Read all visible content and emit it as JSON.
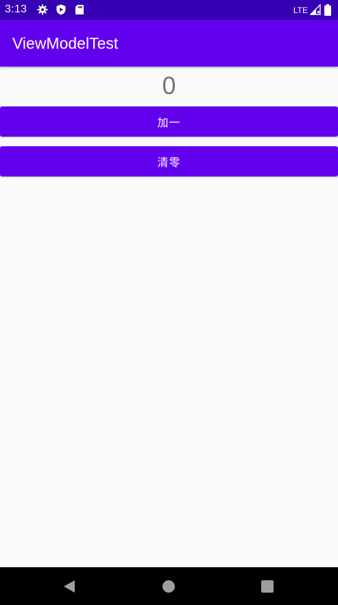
{
  "status_bar": {
    "time": "3:13",
    "network": "LTE",
    "icons": [
      "settings-icon",
      "play-protect-icon",
      "sd-card-icon",
      "signal-icon",
      "battery-icon"
    ]
  },
  "app_bar": {
    "title": "ViewModelTest"
  },
  "content": {
    "counter_value": "0",
    "add_button_label": "加一",
    "clear_button_label": "清零"
  },
  "nav_bar": {
    "icons": [
      "back-icon",
      "home-icon",
      "recents-icon"
    ]
  },
  "colors": {
    "status_bar": "#3700b3",
    "primary": "#6200ee",
    "background": "#fafafa",
    "counter_text": "#757575"
  }
}
